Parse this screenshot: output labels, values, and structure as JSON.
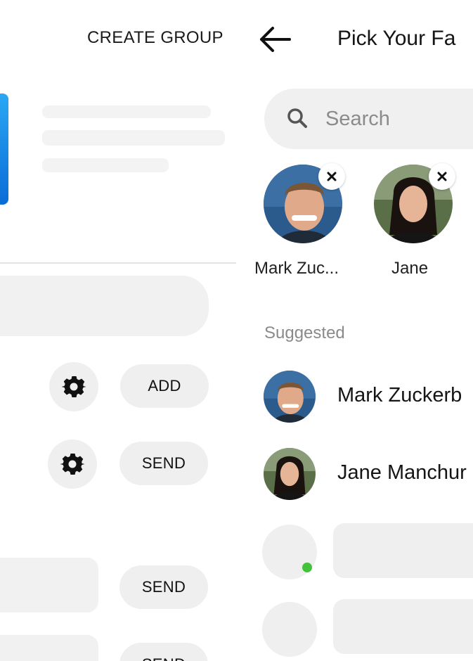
{
  "left": {
    "create_group_label": "CREATE GROUP",
    "buttons": [
      {
        "label": "ADD"
      },
      {
        "label": "SEND"
      },
      {
        "label": "SEND"
      },
      {
        "label": "SEND"
      }
    ]
  },
  "right": {
    "title": "Pick Your Fa",
    "search": {
      "placeholder": "Search"
    },
    "selected": [
      {
        "name": "Mark Zuc..."
      },
      {
        "name": "Jane"
      }
    ],
    "suggested_label": "Suggested",
    "suggestions": [
      {
        "name": "Mark Zuckerb"
      },
      {
        "name": "Jane Manchur"
      }
    ]
  },
  "colors": {
    "accent_blue": "#0a6cd6",
    "online_green": "#42c33a",
    "placeholder_gray": "#efefef"
  }
}
